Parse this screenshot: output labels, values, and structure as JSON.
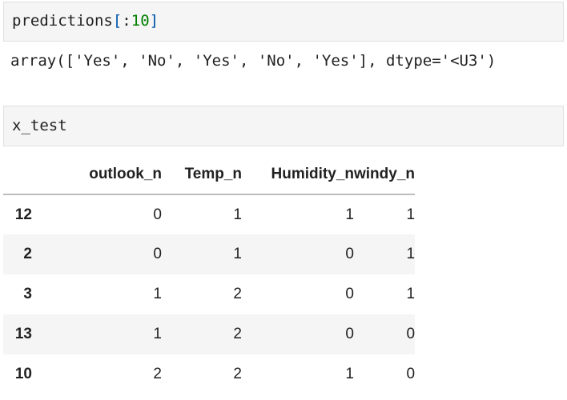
{
  "cells": [
    {
      "input": {
        "name": "predictions",
        "open_bracket": "[",
        "slice_colon": ":",
        "slice_number": "10",
        "close_bracket": "]"
      },
      "output": "array(['Yes', 'No', 'Yes', 'No', 'Yes'], dtype='<U3')"
    },
    {
      "input": {
        "name": "x_test"
      },
      "output_table": {
        "columns": [
          "outlook_n",
          "Temp_n",
          "Humidity_n",
          "windy_n"
        ],
        "rows": [
          {
            "index": "12",
            "values": [
              "0",
              "1",
              "1",
              "1"
            ]
          },
          {
            "index": "2",
            "values": [
              "0",
              "1",
              "0",
              "1"
            ]
          },
          {
            "index": "3",
            "values": [
              "1",
              "2",
              "0",
              "1"
            ]
          },
          {
            "index": "13",
            "values": [
              "1",
              "2",
              "0",
              "0"
            ]
          },
          {
            "index": "10",
            "values": [
              "2",
              "2",
              "1",
              "0"
            ]
          }
        ]
      }
    }
  ],
  "colors": {
    "cell_background": "#f5f5f5",
    "cell_border": "#e0e0e0",
    "code_text": "#212121",
    "bracket_color": "#0055aa",
    "number_color": "#008000",
    "table_stripe": "#f5f5f5",
    "header_rule": "#bdbdbd"
  }
}
